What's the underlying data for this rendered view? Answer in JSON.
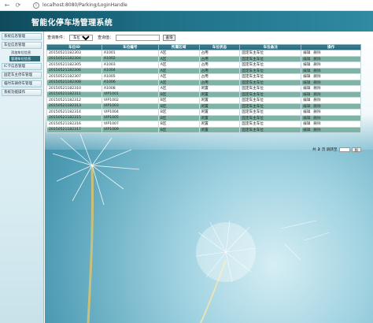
{
  "browser": {
    "url": "localhost:8080/Parking/LoginHandle",
    "back_glyph": "←",
    "reload_glyph": "⟳",
    "info_glyph": "i"
  },
  "header": {
    "title": "智能化停车场管理系统"
  },
  "sidebar": {
    "items": [
      {
        "label": "系统信息管理"
      },
      {
        "label": "车位信息管理"
      },
      {
        "label": "添加车位信息"
      },
      {
        "label": "管理车位信息"
      },
      {
        "label": "IC卡信息管理"
      },
      {
        "label": "固定车主停车管理"
      },
      {
        "label": "临时车辆停车管理"
      },
      {
        "label": "系统功能操作"
      }
    ]
  },
  "search": {
    "condition_label": "查询条件：",
    "condition_value": "车位ID",
    "value_label": "查询值：",
    "value_input": "",
    "button_label": "查询"
  },
  "table": {
    "headers": [
      "车位ID",
      "车位编号",
      "所属区域",
      "车位状态",
      "车位备注",
      "操作"
    ],
    "rows": [
      [
        "20150521182303",
        "A1001",
        "A区",
        "占用",
        "固定车主车位"
      ],
      [
        "20150521182304",
        "A1002",
        "A区",
        "占用",
        "固定车主车位"
      ],
      [
        "20150521182305",
        "A1003",
        "A区",
        "占用",
        "固定车主车位"
      ],
      [
        "20150521182306",
        "A1004",
        "A区",
        "占用",
        "固定车主车位"
      ],
      [
        "20150521182307",
        "A1005",
        "A区",
        "占用",
        "固定车主车位"
      ],
      [
        "20150521182308",
        "A1006",
        "A区",
        "占用",
        "固定车主车位"
      ],
      [
        "20150521182310",
        "A1008",
        "A区",
        "闲置",
        "固定车主车位"
      ],
      [
        "20150521182311",
        "VIP1001",
        "B区",
        "闲置",
        "固定车主车位"
      ],
      [
        "20150521182312",
        "VIP1002",
        "B区",
        "闲置",
        "固定车主车位"
      ],
      [
        "20150521182313",
        "VIP1003",
        "B区",
        "闲置",
        "固定车主车位"
      ],
      [
        "20150521182314",
        "VIP1004",
        "B区",
        "闲置",
        "固定车主车位"
      ],
      [
        "20150521182315",
        "VIP1005",
        "B区",
        "闲置",
        "固定车主车位"
      ],
      [
        "20150521182316",
        "VIP1007",
        "B区",
        "闲置",
        "固定车主车位"
      ],
      [
        "20150521182317",
        "VIP1009",
        "B区",
        "闲置",
        "固定车主车位"
      ]
    ],
    "edit_label": "编辑",
    "delete_label": "删除"
  },
  "pager": {
    "prefix": "共",
    "total_pages": "2",
    "suffix": "页 跳转至",
    "input_value": "",
    "go_label": "到"
  },
  "colors": {
    "header": "#1e6f86",
    "row_alt": "#7fb3a3",
    "table_header": "#26697d"
  }
}
